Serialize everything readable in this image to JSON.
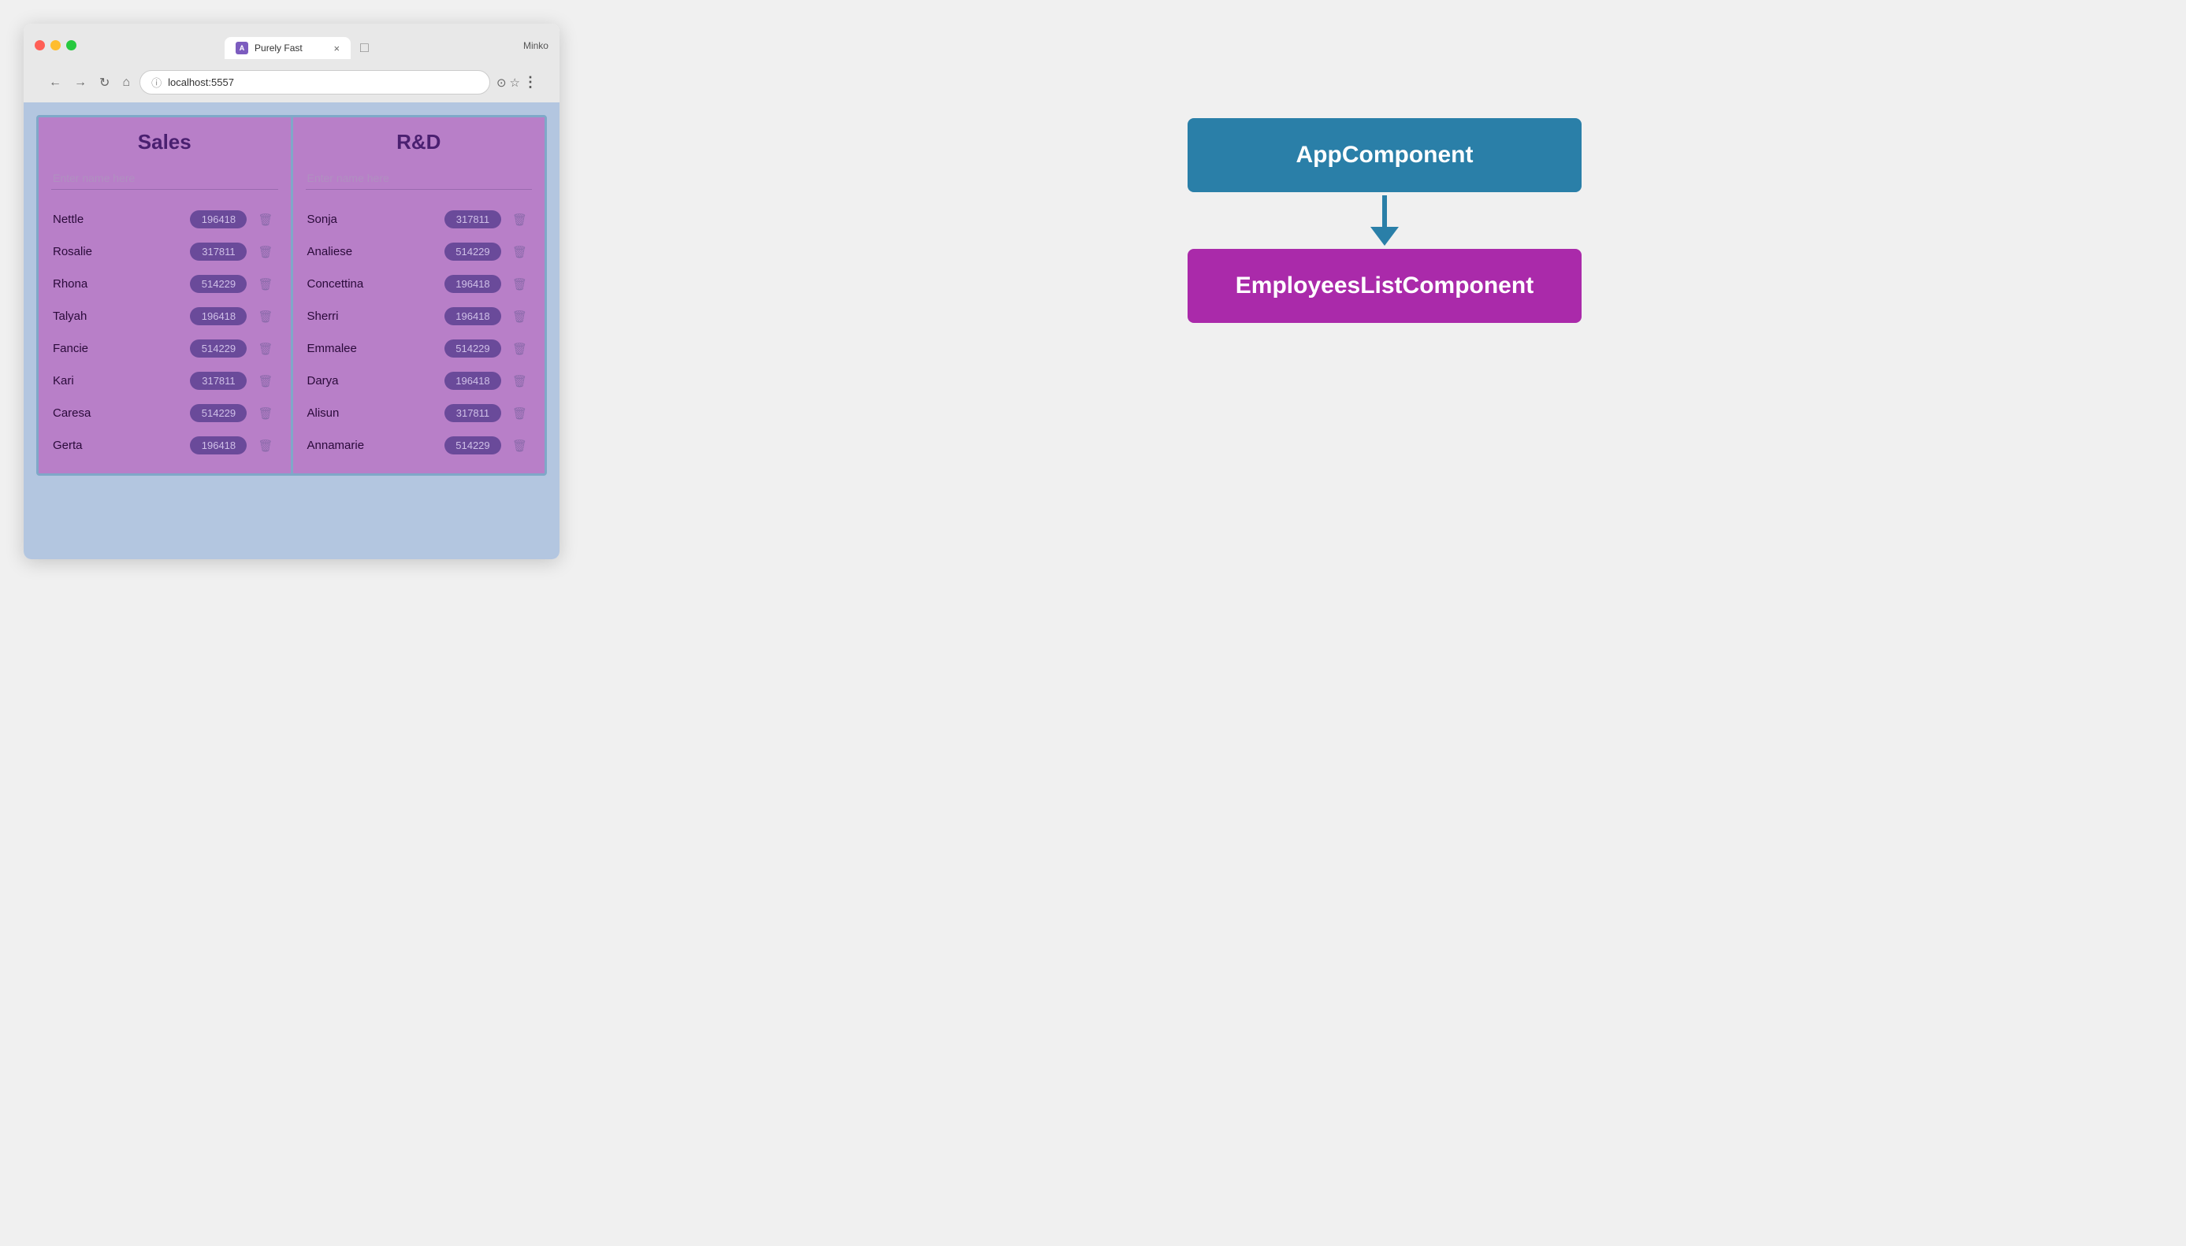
{
  "browser": {
    "tab_title": "Purely Fast",
    "tab_icon_label": "A",
    "tab_close": "×",
    "tab_new_label": "□",
    "user_label": "Minko",
    "url": "localhost:5557",
    "nav": {
      "back": "←",
      "forward": "→",
      "reload": "↻",
      "home": "⌂"
    },
    "url_actions": {
      "share": "⊙",
      "star": "☆",
      "more": "⋮"
    }
  },
  "departments": {
    "sales": {
      "title": "Sales",
      "input_placeholder": "Enter name here",
      "employees": [
        {
          "name": "Nettle",
          "badge": "196418"
        },
        {
          "name": "Rosalie",
          "badge": "317811"
        },
        {
          "name": "Rhona",
          "badge": "514229"
        },
        {
          "name": "Talyah",
          "badge": "196418"
        },
        {
          "name": "Fancie",
          "badge": "514229"
        },
        {
          "name": "Kari",
          "badge": "317811"
        },
        {
          "name": "Caresa",
          "badge": "514229"
        },
        {
          "name": "Gerta",
          "badge": "196418"
        }
      ]
    },
    "rnd": {
      "title": "R&D",
      "input_placeholder": "Enter name here",
      "employees": [
        {
          "name": "Sonja",
          "badge": "317811"
        },
        {
          "name": "Analiese",
          "badge": "514229"
        },
        {
          "name": "Concettina",
          "badge": "196418"
        },
        {
          "name": "Sherri",
          "badge": "196418"
        },
        {
          "name": "Emmalee",
          "badge": "514229"
        },
        {
          "name": "Darya",
          "badge": "196418"
        },
        {
          "name": "Alisun",
          "badge": "317811"
        },
        {
          "name": "Annamarie",
          "badge": "514229"
        }
      ]
    }
  },
  "diagram": {
    "app_component_label": "AppComponent",
    "employees_list_component_label": "EmployeesListComponent"
  }
}
